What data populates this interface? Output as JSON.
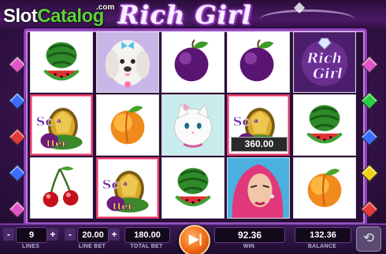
{
  "header": {
    "logo_prefix": "Slot",
    "logo_highlight": "Catalog",
    "logo_suffix": ".com",
    "game_title": "Rich Girl"
  },
  "reels": [
    [
      {
        "symbol": "watermelon",
        "win": false
      },
      {
        "symbol": "scatter",
        "win": true,
        "label": "Scatter"
      },
      {
        "symbol": "cherries",
        "win": false
      }
    ],
    [
      {
        "symbol": "dog",
        "win": false
      },
      {
        "symbol": "peach",
        "win": false
      },
      {
        "symbol": "scatter",
        "win": true,
        "label": "Scatter"
      }
    ],
    [
      {
        "symbol": "plum",
        "win": false
      },
      {
        "symbol": "cat",
        "win": false
      },
      {
        "symbol": "watermelon",
        "win": false
      }
    ],
    [
      {
        "symbol": "plum",
        "win": false
      },
      {
        "symbol": "scatter",
        "win": true,
        "label": "Scatter",
        "win_amount": "360.00"
      },
      {
        "symbol": "rich-girl",
        "win": false
      }
    ],
    [
      {
        "symbol": "rich-girl-logo",
        "win": false,
        "label": "Rich Girl"
      },
      {
        "symbol": "watermelon",
        "win": false
      },
      {
        "symbol": "peach",
        "win": false
      }
    ]
  ],
  "side_gems": {
    "colors": [
      "#e056c8",
      "#3a6cff",
      "#e23a3a",
      "#3a6cff",
      "#e056c8"
    ],
    "right_colors": [
      "#e056c8",
      "#2ecc40",
      "#3a6cff",
      "#f1d21a",
      "#e23a3a"
    ]
  },
  "controls": {
    "lines": {
      "value": "9",
      "label": "LINES"
    },
    "line_bet": {
      "value": "20.00",
      "label": "LINE BET"
    },
    "total_bet": {
      "value": "180.00",
      "label": "TOTAL BET"
    },
    "win": {
      "value": "92.36",
      "label": "WIN"
    },
    "balance": {
      "value": "132.36",
      "label": "BALANCE"
    },
    "minus": "-",
    "plus": "+",
    "spin_icon": "play-skip-icon",
    "settings_icon": "settings-icon"
  },
  "colors": {
    "accent": "#f26a12",
    "frame": "#8d3fb5",
    "win_border": "#e0406a"
  }
}
